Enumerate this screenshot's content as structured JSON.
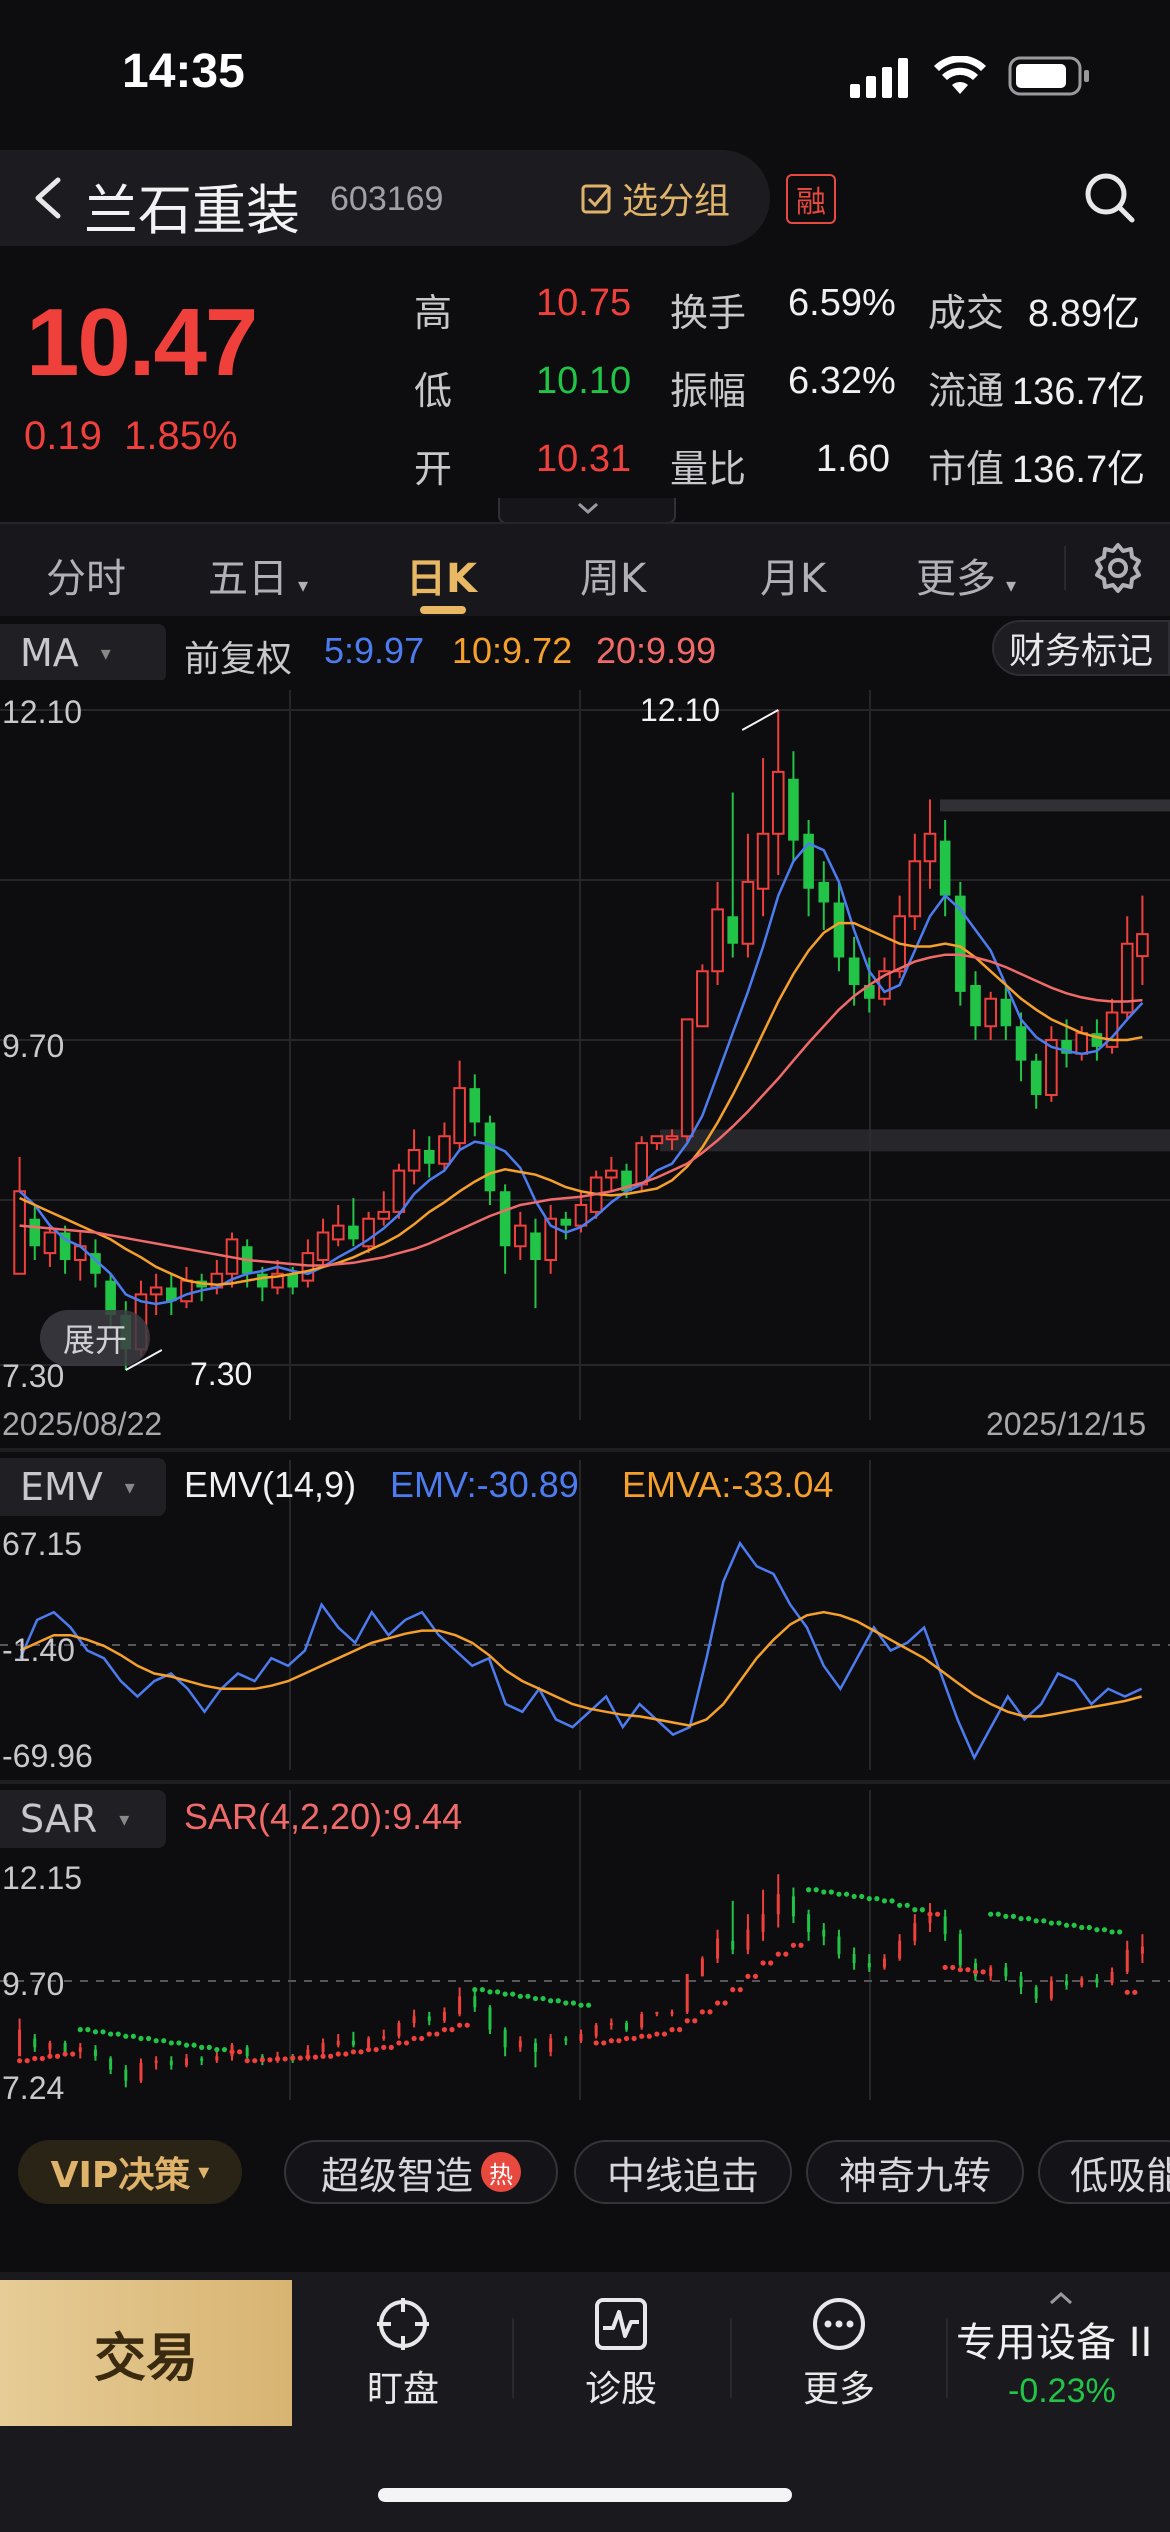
{
  "status_bar": {
    "time": "14:35"
  },
  "header": {
    "stock_name": "兰石重装",
    "stock_code": "603169",
    "group_button": "选分组",
    "margin_badge": "融"
  },
  "quote": {
    "price": "10.47",
    "change": "0.19",
    "change_pct": "1.85%",
    "rows": [
      {
        "l1": "高",
        "v1": "10.75",
        "l2": "换手",
        "v2": "6.59%",
        "l3": "成交",
        "v3": "8.89亿"
      },
      {
        "l1": "低",
        "v1": "10.10",
        "l2": "振幅",
        "v2": "6.32%",
        "l3": "流通",
        "v3": "136.7亿"
      },
      {
        "l1": "开",
        "v1": "10.31",
        "l2": "量比",
        "v2": "1.60",
        "l3": "市值",
        "v3": "136.7亿"
      }
    ]
  },
  "tabs": [
    "分时",
    "五日",
    "日K",
    "周K",
    "月K",
    "更多"
  ],
  "active_tab": "日K",
  "kline_panel": {
    "indicator": "MA",
    "adjust": "前复权",
    "ma5": "5:9.97",
    "ma10": "10:9.72",
    "ma20": "20:9.99",
    "finance_button": "财务标记",
    "y_top": "12.10",
    "y_mid": "9.70",
    "y_bot": "7.30",
    "high_label": "12.10",
    "low_label": "7.30",
    "expand_button": "展开",
    "date_start": "2025/08/22",
    "date_end": "2025/12/15"
  },
  "emv_panel": {
    "indicator": "EMV",
    "title": "EMV(14,9)",
    "emv": "EMV:-30.89",
    "emva": "EMVA:-33.04",
    "y_top": "67.15",
    "y_mid": "-1.40",
    "y_bot": "-69.96"
  },
  "sar_panel": {
    "indicator": "SAR",
    "title": "SAR(4,2,20):9.44",
    "y_top": "12.15",
    "y_mid": "9.70",
    "y_bot": "7.24"
  },
  "strategies": {
    "vip": "VIP决策",
    "chips": [
      "超级智造",
      "中线追击",
      "神奇九转",
      "低吸能"
    ],
    "hot": "热"
  },
  "bottom_bar": {
    "trade": "交易",
    "watch": "盯盘",
    "diagnose": "诊股",
    "more": "更多",
    "sector": "专用设备 II",
    "sector_change": "-0.23%"
  },
  "colors": {
    "up": "#f0403c",
    "down": "#22c447",
    "ma5": "#4c7cf0",
    "ma10": "#f5a02a",
    "ma20": "#f06a6a",
    "gold": "#e8b865"
  },
  "chart_data": [
    {
      "type": "candlestick",
      "title": "日K",
      "x_range": [
        "2025/08/22",
        "2025/12/15"
      ],
      "ylim": [
        7.3,
        12.1
      ],
      "candles": [
        [
          8.0,
          8.6,
          8.05,
          8.85
        ],
        [
          8.4,
          8.2,
          8.1,
          8.5
        ],
        [
          8.15,
          8.3,
          8.05,
          8.35
        ],
        [
          8.3,
          8.1,
          8.0,
          8.35
        ],
        [
          8.1,
          8.2,
          7.95,
          8.3
        ],
        [
          8.15,
          8.0,
          7.9,
          8.25
        ],
        [
          7.95,
          7.7,
          7.6,
          8.0
        ],
        [
          7.7,
          7.45,
          7.3,
          7.8
        ],
        [
          7.45,
          7.85,
          7.4,
          7.95
        ],
        [
          7.85,
          7.9,
          7.7,
          8.0
        ],
        [
          7.9,
          7.8,
          7.7,
          8.0
        ],
        [
          7.8,
          7.95,
          7.75,
          8.05
        ],
        [
          7.95,
          7.9,
          7.8,
          8.0
        ],
        [
          7.9,
          8.0,
          7.85,
          8.1
        ],
        [
          8.0,
          8.25,
          7.9,
          8.3
        ],
        [
          8.2,
          8.0,
          7.9,
          8.25
        ],
        [
          8.0,
          7.9,
          7.8,
          8.05
        ],
        [
          7.9,
          8.0,
          7.85,
          8.1
        ],
        [
          8.0,
          7.9,
          7.85,
          8.05
        ],
        [
          7.95,
          8.15,
          7.9,
          8.25
        ],
        [
          8.1,
          8.3,
          8.05,
          8.4
        ],
        [
          8.25,
          8.35,
          8.2,
          8.5
        ],
        [
          8.35,
          8.25,
          8.2,
          8.55
        ],
        [
          8.2,
          8.4,
          8.15,
          8.45
        ],
        [
          8.4,
          8.45,
          8.35,
          8.6
        ],
        [
          8.45,
          8.75,
          8.4,
          8.8
        ],
        [
          8.75,
          8.9,
          8.65,
          9.05
        ],
        [
          8.9,
          8.8,
          8.7,
          9.0
        ],
        [
          8.8,
          9.0,
          8.75,
          9.1
        ],
        [
          8.95,
          9.35,
          8.9,
          9.55
        ],
        [
          9.35,
          9.1,
          9.0,
          9.45
        ],
        [
          9.1,
          8.6,
          8.5,
          9.15
        ],
        [
          8.6,
          8.2,
          8.0,
          8.65
        ],
        [
          8.2,
          8.35,
          8.1,
          8.45
        ],
        [
          8.3,
          8.1,
          7.75,
          8.4
        ],
        [
          8.1,
          8.4,
          8.0,
          8.5
        ],
        [
          8.4,
          8.35,
          8.25,
          8.45
        ],
        [
          8.35,
          8.5,
          8.3,
          8.6
        ],
        [
          8.45,
          8.7,
          8.4,
          8.75
        ],
        [
          8.7,
          8.75,
          8.6,
          8.85
        ],
        [
          8.75,
          8.6,
          8.55,
          8.8
        ],
        [
          8.65,
          8.95,
          8.6,
          9.0
        ],
        [
          8.95,
          9.0,
          8.9,
          9.0
        ],
        [
          9.0,
          9.0,
          8.9,
          9.05
        ],
        [
          9.0,
          9.85,
          8.95,
          9.85
        ],
        [
          9.8,
          10.2,
          9.8,
          10.25
        ],
        [
          10.2,
          10.65,
          10.1,
          10.85
        ],
        [
          10.6,
          10.4,
          10.3,
          11.5
        ],
        [
          10.4,
          10.85,
          10.3,
          11.2
        ],
        [
          10.8,
          11.2,
          10.6,
          11.75
        ],
        [
          11.2,
          11.65,
          10.9,
          12.1
        ],
        [
          11.6,
          11.15,
          11.0,
          11.8
        ],
        [
          11.2,
          10.8,
          10.6,
          11.3
        ],
        [
          10.85,
          10.7,
          10.5,
          11.0
        ],
        [
          10.7,
          10.3,
          10.2,
          10.85
        ],
        [
          10.3,
          10.1,
          9.95,
          10.45
        ],
        [
          10.1,
          10.0,
          9.9,
          10.3
        ],
        [
          10.0,
          10.2,
          9.95,
          10.3
        ],
        [
          10.2,
          10.6,
          10.15,
          10.75
        ],
        [
          10.6,
          11.0,
          10.5,
          11.2
        ],
        [
          11.0,
          11.2,
          10.8,
          11.45
        ],
        [
          11.15,
          10.75,
          10.6,
          11.3
        ],
        [
          10.75,
          10.05,
          9.95,
          10.85
        ],
        [
          10.1,
          9.8,
          9.7,
          10.2
        ],
        [
          9.8,
          10.0,
          9.7,
          10.05
        ],
        [
          10.0,
          9.8,
          9.7,
          10.1
        ],
        [
          9.8,
          9.55,
          9.4,
          9.9
        ],
        [
          9.55,
          9.3,
          9.2,
          9.6
        ],
        [
          9.3,
          9.7,
          9.25,
          9.8
        ],
        [
          9.7,
          9.6,
          9.5,
          9.85
        ],
        [
          9.6,
          9.75,
          9.55,
          9.8
        ],
        [
          9.75,
          9.65,
          9.55,
          9.85
        ],
        [
          9.65,
          9.9,
          9.6,
          10.0
        ],
        [
          9.9,
          10.4,
          9.85,
          10.6
        ],
        [
          10.31,
          10.47,
          10.1,
          10.75
        ]
      ],
      "series": [
        {
          "name": "5",
          "values": [
            8.6,
            8.5,
            8.35,
            8.25,
            8.2,
            8.1,
            8.0,
            7.85,
            7.8,
            7.78,
            7.8,
            7.85,
            7.88,
            7.9,
            7.96,
            8.0,
            8.02,
            8.05,
            8.02,
            8.0,
            8.05,
            8.12,
            8.18,
            8.25,
            8.33,
            8.43,
            8.58,
            8.68,
            8.75,
            8.9,
            8.96,
            8.94,
            8.89,
            8.77,
            8.53,
            8.35,
            8.3,
            8.34,
            8.42,
            8.52,
            8.6,
            8.65,
            8.75,
            8.8,
            8.95,
            9.15,
            9.45,
            9.75,
            10.05,
            10.38,
            10.75,
            11.0,
            11.13,
            11.08,
            10.85,
            10.5,
            10.2,
            10.05,
            10.1,
            10.35,
            10.6,
            10.75,
            10.65,
            10.5,
            10.35,
            10.1,
            9.85,
            9.72,
            9.65,
            9.62,
            9.6,
            9.62,
            9.72,
            9.85,
            9.97
          ]
        },
        {
          "name": "10",
          "values": [
            8.55,
            8.5,
            8.45,
            8.4,
            8.35,
            8.3,
            8.25,
            8.18,
            8.12,
            8.05,
            8.0,
            7.95,
            7.93,
            7.92,
            7.93,
            7.95,
            7.97,
            7.98,
            8.0,
            8.02,
            8.05,
            8.08,
            8.12,
            8.17,
            8.22,
            8.28,
            8.36,
            8.45,
            8.52,
            8.6,
            8.67,
            8.73,
            8.76,
            8.74,
            8.72,
            8.68,
            8.63,
            8.6,
            8.58,
            8.57,
            8.58,
            8.6,
            8.62,
            8.68,
            8.78,
            8.92,
            9.1,
            9.3,
            9.52,
            9.75,
            9.98,
            10.18,
            10.35,
            10.48,
            10.55,
            10.55,
            10.5,
            10.45,
            10.4,
            10.38,
            10.38,
            10.4,
            10.38,
            10.3,
            10.2,
            10.1,
            10.0,
            9.92,
            9.85,
            9.8,
            9.75,
            9.72,
            9.7,
            9.7,
            9.72
          ]
        },
        {
          "name": "20",
          "values": [
            8.35,
            8.34,
            8.33,
            8.32,
            8.31,
            8.3,
            8.28,
            8.26,
            8.24,
            8.22,
            8.2,
            8.18,
            8.16,
            8.14,
            8.12,
            8.1,
            8.09,
            8.08,
            8.07,
            8.06,
            8.06,
            8.07,
            8.08,
            8.1,
            8.12,
            8.15,
            8.18,
            8.22,
            8.27,
            8.32,
            8.37,
            8.42,
            8.46,
            8.5,
            8.52,
            8.54,
            8.55,
            8.56,
            8.58,
            8.6,
            8.63,
            8.66,
            8.7,
            8.75,
            8.8,
            8.88,
            8.97,
            9.07,
            9.18,
            9.3,
            9.42,
            9.55,
            9.68,
            9.8,
            9.92,
            10.02,
            10.1,
            10.17,
            10.22,
            10.27,
            10.3,
            10.32,
            10.32,
            10.3,
            10.27,
            10.23,
            10.18,
            10.13,
            10.08,
            10.04,
            10.01,
            9.99,
            9.98,
            9.98,
            9.99
          ]
        }
      ]
    },
    {
      "type": "line",
      "title": "EMV(14,9)",
      "ylim": [
        -69.96,
        67.15
      ],
      "series": [
        {
          "name": "EMV",
          "values": [
            -10,
            15,
            20,
            10,
            -5,
            -10,
            -25,
            -35,
            -25,
            -20,
            -30,
            -45,
            -30,
            -20,
            -25,
            -10,
            -15,
            -5,
            25,
            10,
            0,
            20,
            5,
            15,
            20,
            5,
            -5,
            -15,
            -10,
            -40,
            -45,
            -30,
            -50,
            -55,
            -45,
            -35,
            -55,
            -40,
            -50,
            -60,
            -55,
            -10,
            40,
            65,
            50,
            45,
            25,
            10,
            -15,
            -30,
            -10,
            10,
            -5,
            0,
            10,
            -20,
            -50,
            -75,
            -55,
            -35,
            -50,
            -40,
            -20,
            -25,
            -40,
            -30,
            -35,
            -30
          ]
        },
        {
          "name": "EMVA",
          "values": [
            -5,
            0,
            5,
            5,
            2,
            -2,
            -8,
            -15,
            -20,
            -22,
            -25,
            -28,
            -30,
            -30,
            -30,
            -28,
            -25,
            -20,
            -15,
            -10,
            -5,
            0,
            3,
            6,
            8,
            8,
            5,
            0,
            -8,
            -18,
            -25,
            -30,
            -35,
            -40,
            -43,
            -45,
            -47,
            -48,
            -50,
            -52,
            -54,
            -50,
            -40,
            -25,
            -10,
            2,
            12,
            18,
            20,
            18,
            14,
            8,
            2,
            -4,
            -10,
            -18,
            -26,
            -34,
            -40,
            -45,
            -48,
            -48,
            -46,
            -44,
            -42,
            -40,
            -38,
            -35
          ]
        }
      ]
    },
    {
      "type": "scatter",
      "title": "SAR(4,2,20)",
      "ylim": [
        7.24,
        12.15
      ],
      "series": [
        {
          "name": "SAR",
          "values": [
            7.9,
            7.95,
            8.0,
            8.05,
            8.6,
            8.55,
            8.5,
            8.45,
            8.4,
            8.35,
            8.3,
            8.25,
            8.2,
            8.15,
            8.1,
            7.9,
            7.92,
            7.94,
            7.96,
            7.98,
            8.0,
            8.05,
            8.1,
            8.15,
            8.2,
            8.3,
            8.4,
            8.5,
            8.6,
            8.7,
            9.5,
            9.45,
            9.4,
            9.35,
            9.3,
            9.25,
            9.2,
            9.15,
            8.3,
            8.35,
            8.4,
            8.45,
            8.5,
            8.6,
            8.8,
            9.0,
            9.2,
            9.5,
            9.8,
            10.1,
            10.3,
            10.5,
            11.75,
            11.7,
            11.65,
            11.6,
            11.55,
            11.5,
            11.4,
            11.3,
            11.2,
            10.0,
            9.95,
            9.9,
            11.2,
            11.15,
            11.1,
            11.05,
            11.0,
            10.95,
            10.9,
            10.85,
            10.8,
            9.44
          ]
        }
      ]
    }
  ]
}
